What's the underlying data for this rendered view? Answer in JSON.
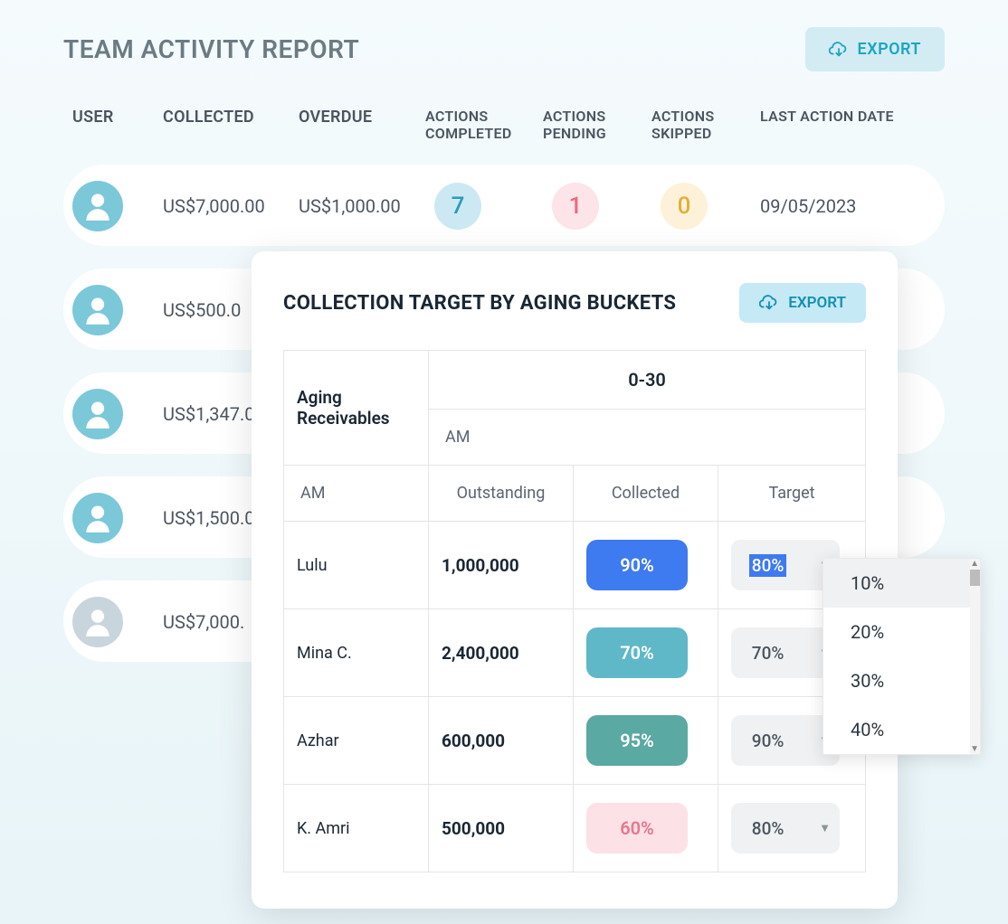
{
  "header": {
    "title": "TEAM ACTIVITY REPORT",
    "export_label": "EXPORT"
  },
  "table": {
    "columns": {
      "user": "USER",
      "collected": "COLLECTED",
      "overdue": "OVERDUE",
      "actions_completed": "ACTIONS COMPLETED",
      "actions_pending": "ACTIONS PENDING",
      "actions_skipped": "ACTIONS SKIPPED",
      "last_action_date": "LAST ACTION DATE"
    },
    "rows": [
      {
        "collected": "US$7,000.00",
        "overdue": "US$1,000.00",
        "actions_completed": "7",
        "actions_pending": "1",
        "actions_skipped": "0",
        "last_action_date": "09/05/2023"
      },
      {
        "collected": "US$500.0"
      },
      {
        "collected": "US$1,347.0"
      },
      {
        "collected": "US$1,500.0"
      },
      {
        "collected": "US$7,000."
      }
    ]
  },
  "modal": {
    "title": "COLLECTION TARGET BY AGING BUCKETS",
    "export_label": "EXPORT",
    "headers": {
      "aging_receivables": "Aging Receivables",
      "bucket": "0-30",
      "am": "AM",
      "outstanding": "Outstanding",
      "collected": "Collected",
      "target": "Target"
    },
    "rows": [
      {
        "am": "Lulu",
        "outstanding": "1,000,000",
        "collected": "90%",
        "target": "80%",
        "collected_color": "blue",
        "target_active": true
      },
      {
        "am": "Mina C.",
        "outstanding": "2,400,000",
        "collected": "70%",
        "target": "70%",
        "collected_color": "teal",
        "target_active": false
      },
      {
        "am": "Azhar",
        "outstanding": "600,000",
        "collected": "95%",
        "target": "90%",
        "collected_color": "tealdark",
        "target_active": false
      },
      {
        "am": "K. Amri",
        "outstanding": "500,000",
        "collected": "60%",
        "target": "80%",
        "collected_color": "pink",
        "target_active": false
      }
    ]
  },
  "dropdown": {
    "options": [
      "10%",
      "20%",
      "30%",
      "40%"
    ]
  }
}
